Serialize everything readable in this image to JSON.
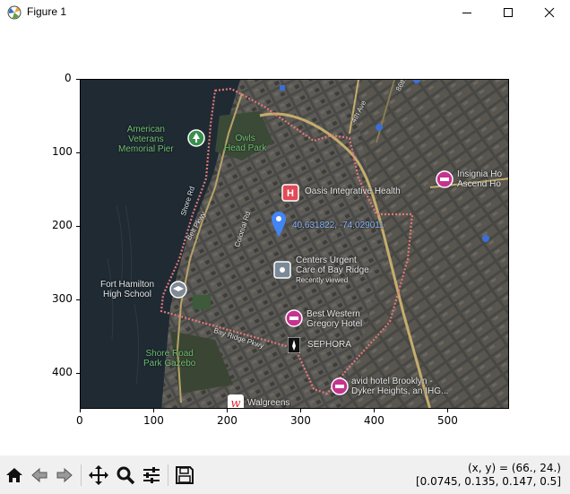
{
  "window": {
    "title": "Figure 1",
    "minimize_icon": "minimize-icon",
    "maximize_icon": "maximize-icon",
    "close_icon": "close-icon"
  },
  "axes": {
    "x_ticks": [
      "0",
      "100",
      "200",
      "300",
      "400",
      "500"
    ],
    "y_ticks": [
      "0",
      "100",
      "200",
      "300",
      "400"
    ]
  },
  "map": {
    "labels": {
      "american_veterans": "American\nVeterans\nMemorial Pier",
      "owls_head": "Owls\nHead Park",
      "oasis": "Oasis Integrative Health",
      "coords_pin": "40.631822, -74.029011",
      "centers_urgent": "Centers Urgent\nCare of Bay Ridge",
      "recently_viewed": "Recently viewed",
      "fort_hamilton": "Fort Hamilton\nHigh School",
      "best_western": "Best Western\nGregory Hotel",
      "sephora": "SEPHORA",
      "shore_road": "Shore Road\nPark Gazebo",
      "avid_hotel": "avid hotel Brooklyn -\nDyker Heights, an IHG...",
      "walgreens": "Walgreens",
      "insignia": "Insignia Ho\nAscend Ho",
      "road_shore": "Shore Rd",
      "road_colonial": "Colonial Rd",
      "road_bay_ridge": "Bay Ridge Pkwy",
      "road_belt": "Belt Pkwy",
      "road_4th": "4th Ave",
      "road_86": "86th St"
    }
  },
  "toolbar": {
    "home_icon": "home-icon",
    "back_icon": "back-arrow-icon",
    "forward_icon": "forward-arrow-icon",
    "pan_icon": "pan-move-icon",
    "zoom_icon": "zoom-magnifier-icon",
    "config_icon": "configure-subplots-icon",
    "save_icon": "save-disk-icon"
  },
  "status": {
    "xy": "(x, y) = (66., 24.)",
    "rgba": "[0.0745, 0.135, 0.147, 0.5]"
  }
}
